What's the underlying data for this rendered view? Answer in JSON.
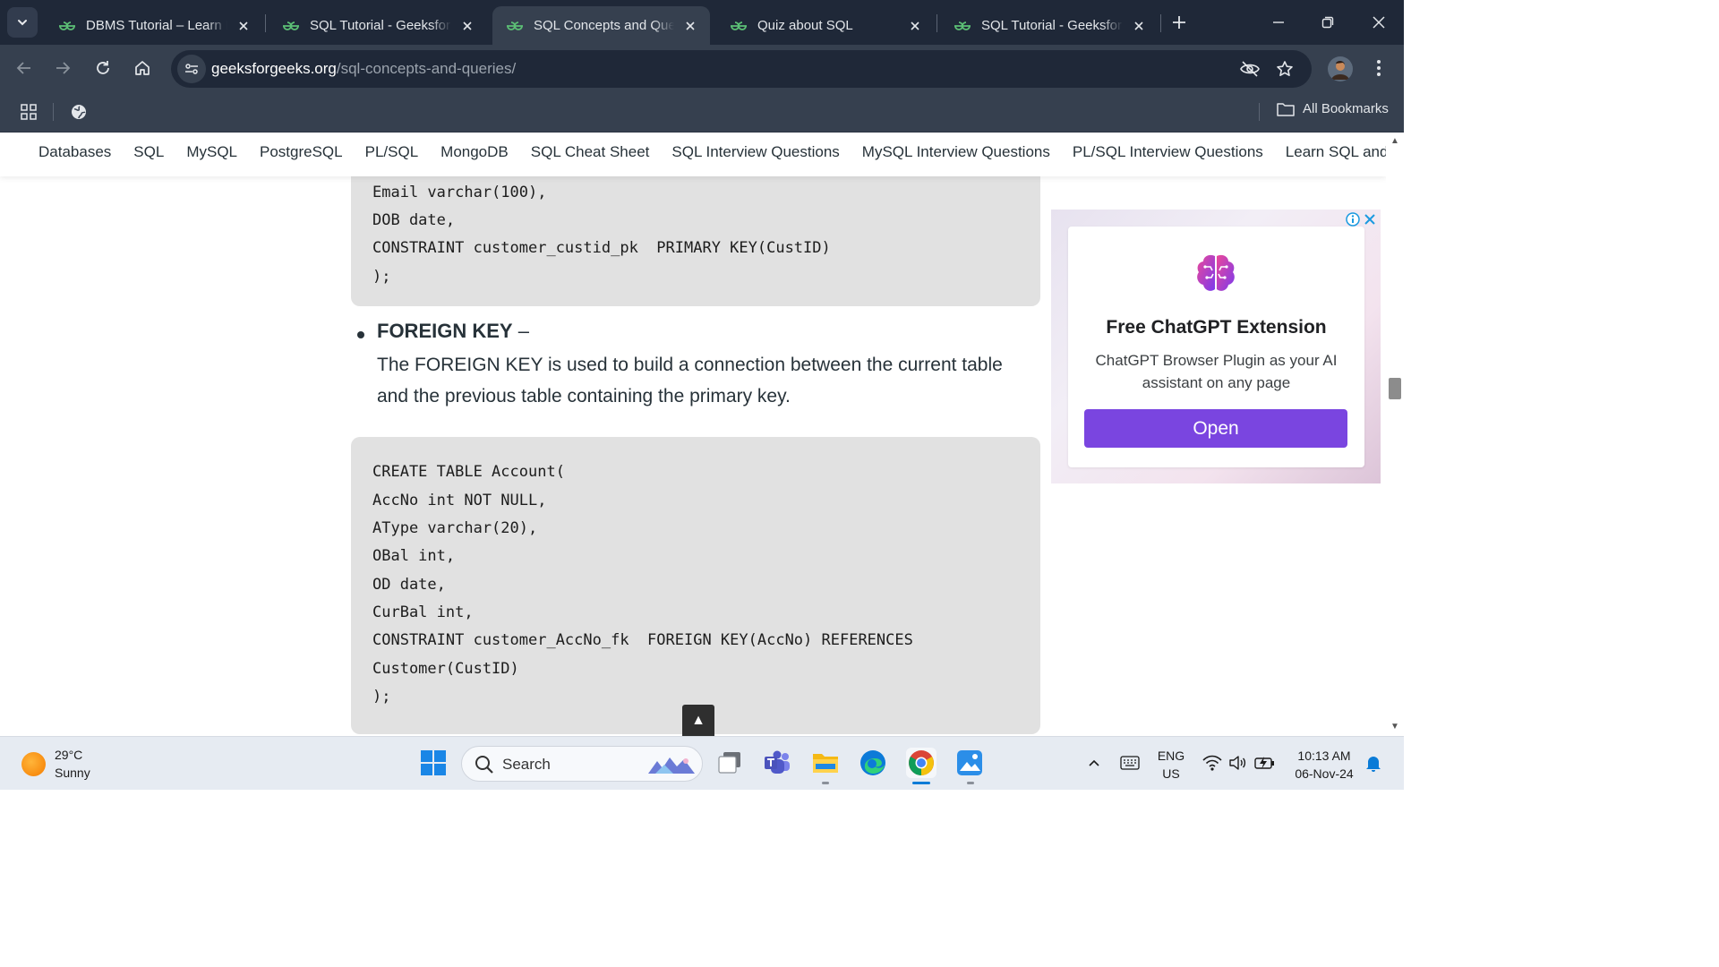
{
  "browser": {
    "tabs": [
      {
        "title": "DBMS Tutorial – Learn Da",
        "active": false
      },
      {
        "title": "SQL Tutorial - GeeksforG",
        "active": false
      },
      {
        "title": "SQL Concepts and Queric",
        "active": true
      },
      {
        "title": "Quiz about SQL",
        "active": false
      },
      {
        "title": "SQL Tutorial - GeeksforG",
        "active": false
      }
    ],
    "url_host": "geeksforgeeks.org",
    "url_path": "/sql-concepts-and-queries/",
    "bookmarks_label": "All Bookmarks"
  },
  "site_nav": {
    "items": [
      "Databases",
      "SQL",
      "MySQL",
      "PostgreSQL",
      "PL/SQL",
      "MongoDB",
      "SQL Cheat Sheet",
      "SQL Interview Questions",
      "MySQL Interview Questions",
      "PL/SQL Interview Questions",
      "Learn SQL and Dat"
    ]
  },
  "article": {
    "code_block_1": [
      "Email varchar(100),",
      "DOB date,",
      "CONSTRAINT customer_custid_pk  PRIMARY KEY(CustID)",
      ");"
    ],
    "section_heading": "FOREIGN KEY",
    "section_heading_suffix": " –",
    "section_text": "The FOREIGN KEY is used to build a connection between the current table and the previous table containing the primary key.",
    "code_block_2": [
      "CREATE TABLE Account(",
      "AccNo int NOT NULL,",
      "AType varchar(20),",
      "OBal int,",
      "OD date,",
      "CurBal int,",
      "CONSTRAINT customer_AccNo_fk  FOREIGN KEY(AccNo) REFERENCES",
      "Customer(CustID)",
      ");"
    ],
    "scroll_top_glyph": "▲"
  },
  "ad": {
    "title": "Free ChatGPT Extension",
    "description": "ChatGPT Browser Plugin as your AI assistant on any page",
    "button_label": "Open",
    "button_color": "#7a45e0"
  },
  "taskbar": {
    "weather_temp": "29°C",
    "weather_desc": "Sunny",
    "search_label": "Search",
    "language_line1": "ENG",
    "language_line2": "US",
    "time": "10:13 AM",
    "date": "06-Nov-24"
  },
  "colors": {
    "tabstrip_bg": "#1f2838",
    "toolbar_bg": "#36404f",
    "gfg_green": "#2f8d46",
    "code_bg": "#e1e1e1"
  }
}
